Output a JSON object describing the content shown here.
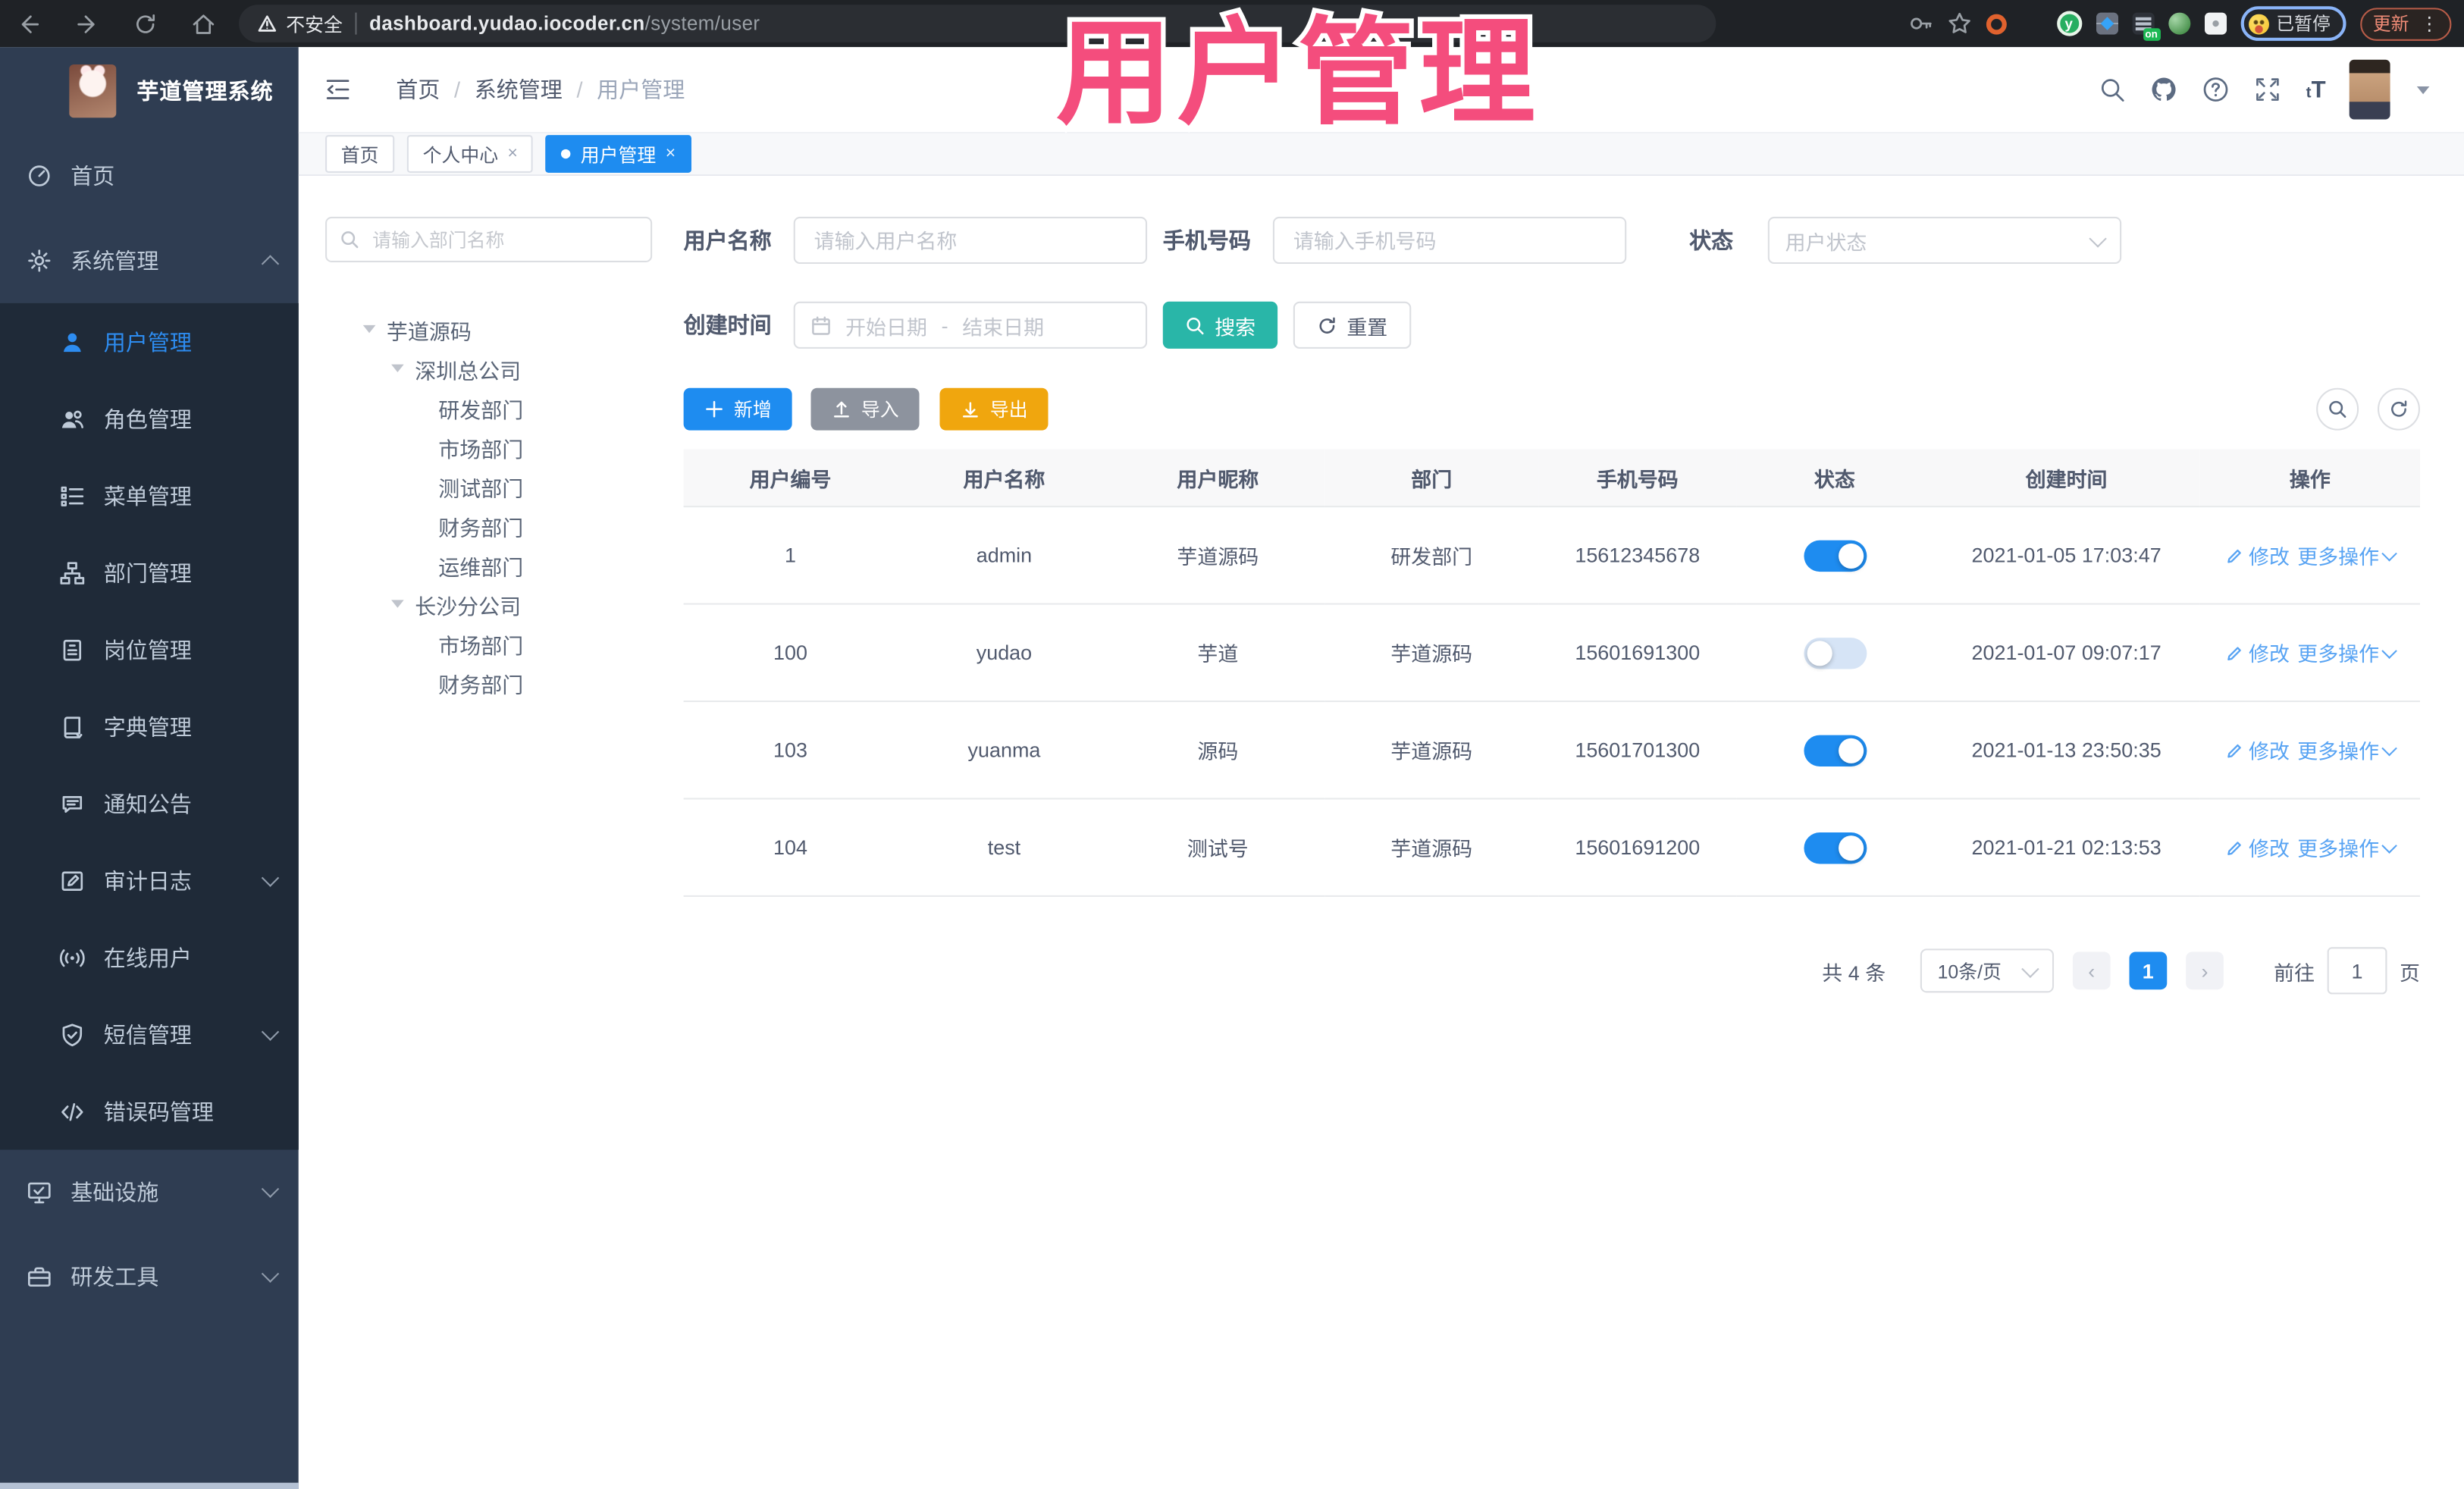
{
  "browser": {
    "security_label": "不安全",
    "url_host": "dashboard.yudao.iocoder.cn",
    "url_path": "/system/user",
    "profile_chip": "已暂停",
    "update_label": "更新"
  },
  "icons": {
    "menu_dots": "⋮",
    "chevron_left": "‹",
    "chevron_right": "›",
    "close": "×"
  },
  "overlay_title": "用户管理",
  "logo": {
    "title": "芋道管理系统"
  },
  "breadcrumb": {
    "separator": "/",
    "items": [
      "首页",
      "系统管理",
      "用户管理"
    ]
  },
  "tabs": [
    {
      "label": "首页"
    },
    {
      "label": "个人中心"
    },
    {
      "label": "用户管理"
    }
  ],
  "sidebar": {
    "items": [
      {
        "label": "首页"
      },
      {
        "label": "系统管理"
      },
      {
        "label": "用户管理"
      },
      {
        "label": "角色管理"
      },
      {
        "label": "菜单管理"
      },
      {
        "label": "部门管理"
      },
      {
        "label": "岗位管理"
      },
      {
        "label": "字典管理"
      },
      {
        "label": "通知公告"
      },
      {
        "label": "审计日志"
      },
      {
        "label": "在线用户"
      },
      {
        "label": "短信管理"
      },
      {
        "label": "错误码管理"
      },
      {
        "label": "基础设施"
      },
      {
        "label": "研发工具"
      }
    ]
  },
  "tree": {
    "search_placeholder": "请输入部门名称",
    "root": {
      "label": "芋道源码",
      "children": [
        {
          "label": "深圳总公司",
          "children": [
            "研发部门",
            "市场部门",
            "测试部门",
            "财务部门",
            "运维部门"
          ]
        },
        {
          "label": "长沙分公司",
          "children": [
            "市场部门",
            "财务部门"
          ]
        }
      ]
    }
  },
  "filters": {
    "username_label": "用户名称",
    "username_placeholder": "请输入用户名称",
    "mobile_label": "手机号码",
    "mobile_placeholder": "请输入手机号码",
    "status_label": "状态",
    "status_placeholder": "用户状态",
    "create_time_label": "创建时间",
    "date_start": "开始日期",
    "date_separator": "-",
    "date_end": "结束日期",
    "search_button": "搜索",
    "reset_button": "重置"
  },
  "toolbar": {
    "add": "新增",
    "import": "导入",
    "export": "导出"
  },
  "table": {
    "columns": [
      "用户编号",
      "用户名称",
      "用户昵称",
      "部门",
      "手机号码",
      "状态",
      "创建时间",
      "操作"
    ],
    "rows": [
      {
        "id": "1",
        "username": "admin",
        "nickname": "芋道源码",
        "dept": "研发部门",
        "mobile": "15612345678",
        "status": true,
        "created": "2021-01-05 17:03:47",
        "edit": "修改",
        "more": "更多操作"
      },
      {
        "id": "100",
        "username": "yudao",
        "nickname": "芋道",
        "dept": "芋道源码",
        "mobile": "15601691300",
        "status": false,
        "created": "2021-01-07 09:07:17",
        "edit": "修改",
        "more": "更多操作"
      },
      {
        "id": "103",
        "username": "yuanma",
        "nickname": "源码",
        "dept": "芋道源码",
        "mobile": "15601701300",
        "status": true,
        "created": "2021-01-13 23:50:35",
        "edit": "修改",
        "more": "更多操作"
      },
      {
        "id": "104",
        "username": "test",
        "nickname": "测试号",
        "dept": "芋道源码",
        "mobile": "15601691200",
        "status": true,
        "created": "2021-01-21 02:13:53",
        "edit": "修改",
        "more": "更多操作"
      }
    ]
  },
  "pagination": {
    "total": "共 4 条",
    "page_size": "10条/页",
    "current_page": "1",
    "goto_label": "前往",
    "goto_value": "1",
    "page_unit": "页"
  },
  "colors": {
    "primary": "#1e8cf0",
    "link_blue": "#57a3f3",
    "search_teal": "#29b6a8",
    "export_orange": "#f0a60e",
    "import_gray": "#8d939e",
    "sidebar_bg": "#2f3d52",
    "submenu_bg": "#1f2a38",
    "overlay_pink": "#f44d7d"
  }
}
